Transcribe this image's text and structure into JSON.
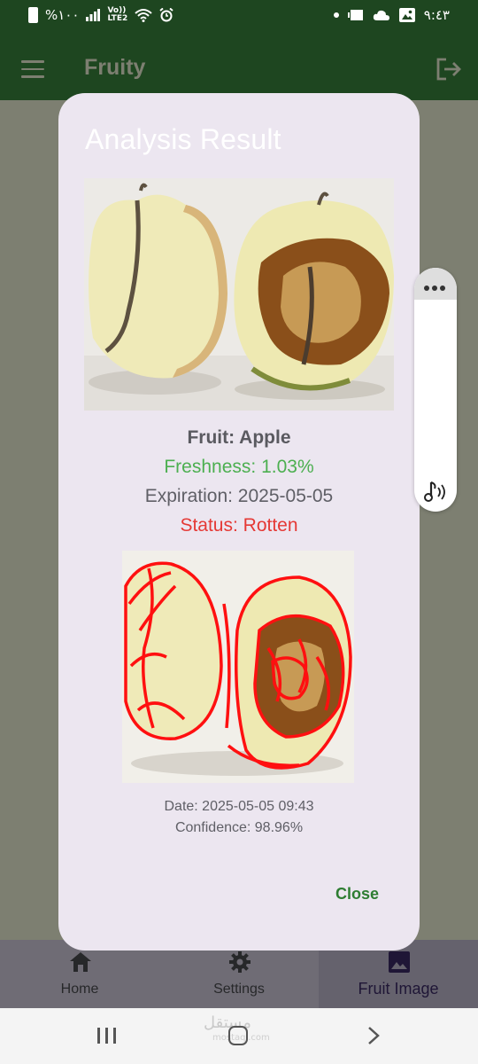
{
  "status_bar": {
    "battery_text": "%١٠٠",
    "network_label_top": "Vo))",
    "network_label_bottom": "LTE2",
    "time": "٩:٤٣"
  },
  "app_bar": {
    "title": "Fruity",
    "menu_icon": "menu-icon",
    "logout_icon": "logout-icon"
  },
  "dialog": {
    "title": "Analysis Result",
    "fruit": "Fruit: Apple",
    "freshness": "Freshness: 1.03%",
    "expiration": "Expiration: 2025-05-05",
    "status": "Status: Rotten",
    "date": "Date: 2025-05-05 09:43",
    "confidence": "Confidence: 98.96%",
    "close_label": "Close",
    "colors": {
      "freshness": "#4caf50",
      "status": "#e53935",
      "close": "#2e7d32"
    }
  },
  "bottom_nav": {
    "items": [
      {
        "label": "Home",
        "icon": "home-icon"
      },
      {
        "label": "Settings",
        "icon": "gear-icon"
      },
      {
        "label": "Fruit Image",
        "icon": "image-icon",
        "active": true
      }
    ]
  },
  "watermark": {
    "text": "مستقل",
    "sub": "mostaql.com"
  },
  "colors": {
    "app_bar": "#1e4620",
    "scrim": "#7d7f71",
    "dialog": "#ece6f0"
  }
}
